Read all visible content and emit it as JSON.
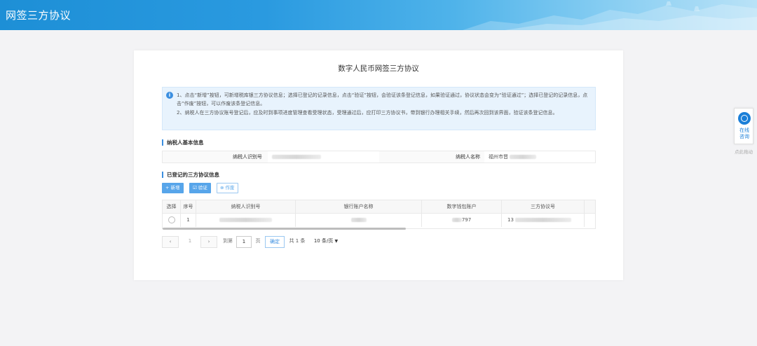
{
  "header": {
    "title": "网签三方协议"
  },
  "card": {
    "title": "数字人民币网签三方协议",
    "notice": {
      "line1": "1、点击“新增”按钮，可新增税库银三方协议信息；选择已登记的记录信息，点击“验证”按钮，会验证该条登记信息，如果验证通过，协议状态会变为“验证通过”；选择已登记的记录信息，点击“作废”按钮，可以作废该条登记信息。",
      "line2": "2、纳税人在三方协议账号登记后，应及时到事项进度管理查看受理状态，受理通过后，应打印三方协议书，带到银行办理相关手续，然后再次回到该界面，验证该条登记信息。"
    },
    "basic_info": {
      "section_title": "纳税人基本信息",
      "taxpayer_id_label": "纳税人识别号",
      "taxpayer_name_label": "纳税人名称",
      "taxpayer_name_value": "福州市晋"
    },
    "protocols": {
      "section_title": "已登记的三方协议信息",
      "buttons": {
        "add": "+ 新增",
        "verify": "☑ 验证",
        "void": "⊗ 作废"
      },
      "columns": [
        "选择",
        "序号",
        "纳税人识别号",
        "银行账户名称",
        "数字钱包账户",
        "三方协议号"
      ],
      "rows": [
        {
          "index": "1",
          "wallet_suffix": "797",
          "protocol_prefix": "13"
        }
      ]
    },
    "pagination": {
      "prev": "‹",
      "current_page": "1",
      "next": "›",
      "goto_label": "到第",
      "goto_value": "1",
      "page_unit": "页",
      "confirm": "确定",
      "total": "共 1 条",
      "page_size": "10 条/页"
    }
  },
  "side": {
    "consult_line1": "在线",
    "consult_line2": "咨询",
    "drag_hint": "点此拖动"
  },
  "colors": {
    "header": "#2a9ae0",
    "accent": "#3b8fe0"
  }
}
